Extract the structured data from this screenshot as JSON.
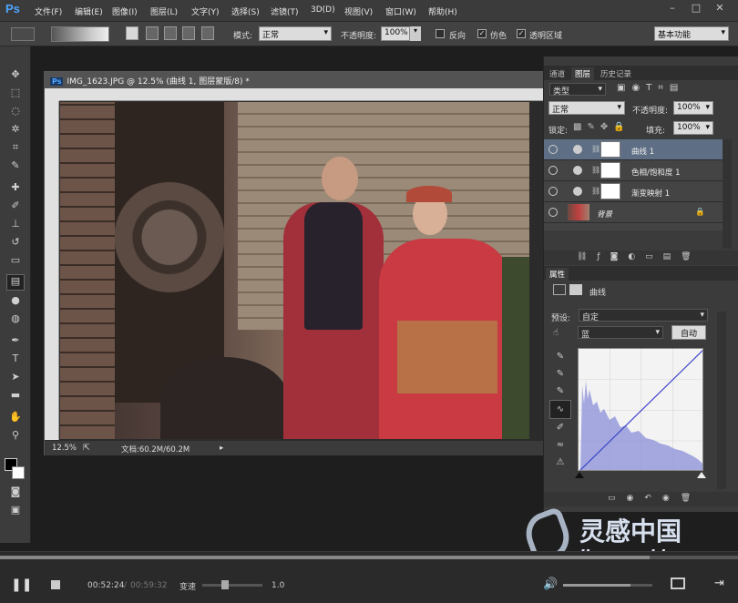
{
  "menubar": {
    "logo": "Ps",
    "items": [
      "文件(F)",
      "编辑(E)",
      "图像(I)",
      "图层(L)",
      "文字(Y)",
      "选择(S)",
      "滤镜(T)",
      "3D(D)",
      "视图(V)",
      "窗口(W)",
      "帮助(H)"
    ],
    "window_buttons": [
      "–",
      "□",
      "✕"
    ]
  },
  "options": {
    "mode_label": "模式:",
    "mode_value": "正常",
    "opacity_label": "不透明度:",
    "opacity_value": "100%",
    "reverse_label": "反向",
    "dither_label": "仿色",
    "transparency_label": "透明区域",
    "workspace_value": "基本功能"
  },
  "document": {
    "title": "IMG_1623.JPG @ 12.5% (曲线 1, 图层蒙版/8) *",
    "zoom": "12.5%",
    "doc_size": "文档:60.2M/60.2M"
  },
  "layers_panel": {
    "tabs": [
      "通道",
      "图层",
      "历史记录"
    ],
    "filter_value": "类型",
    "blend_value": "正常",
    "opacity_label": "不透明度:",
    "opacity_value": "100%",
    "lock_label": "锁定:",
    "fill_label": "填充:",
    "fill_value": "100%",
    "layers": [
      {
        "name": "曲线 1",
        "selected": true
      },
      {
        "name": "色相/饱和度 1",
        "selected": false
      },
      {
        "name": "渐变映射 1",
        "selected": false
      },
      {
        "name": "背景",
        "selected": false
      }
    ]
  },
  "properties_panel": {
    "tab": "属性",
    "title": "曲线",
    "preset_label": "预设:",
    "preset_value": "自定",
    "channel_value": "蓝",
    "auto_label": "自动"
  },
  "player": {
    "current_time": "00:52:24",
    "separator": "/",
    "total_time": "00:59:32",
    "speed_label": "变速",
    "speed_value": "1.0",
    "volume_level": 0.75
  },
  "watermark": {
    "site_cn": "灵感中国",
    "site_en": "lingganchina.com"
  },
  "colors": {
    "accent_blue": "#4da6ff",
    "selected_row": "#5e6f85"
  }
}
